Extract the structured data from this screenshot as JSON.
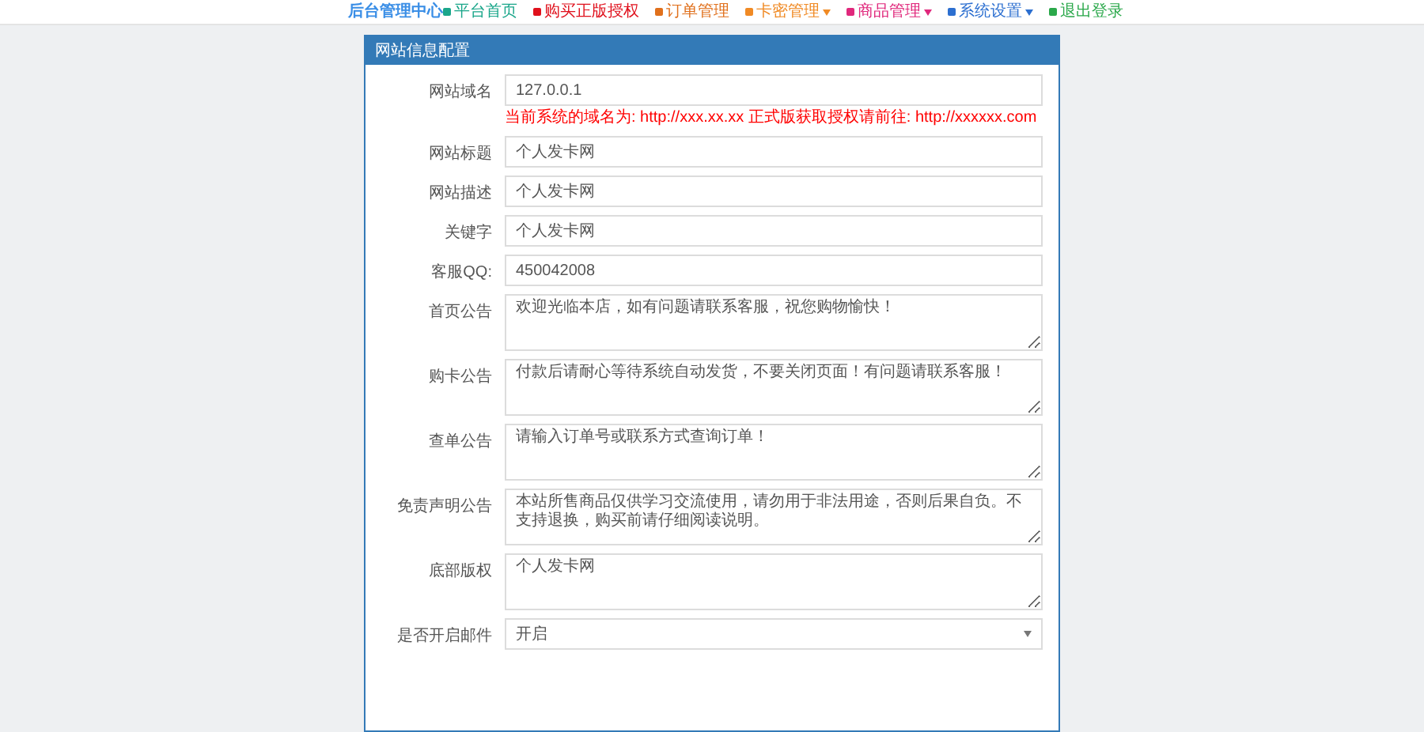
{
  "brand": "后台管理中心",
  "nav": [
    {
      "label": "平台首页",
      "color": "#1aa68a",
      "kind": "link"
    },
    {
      "label": "购买正版授权",
      "color": "#e0101c",
      "kind": "link"
    },
    {
      "label": "订单管理",
      "color": "#e0701c",
      "kind": "link"
    },
    {
      "label": "卡密管理",
      "color": "#f08a24",
      "kind": "menu"
    },
    {
      "label": "商品管理",
      "color": "#e0287c",
      "kind": "menu"
    },
    {
      "label": "系统设置",
      "color": "#2c6fd0",
      "kind": "menu"
    },
    {
      "label": "退出登录",
      "color": "#2aa84a",
      "kind": "link"
    }
  ],
  "panel": {
    "title": "网站信息配置",
    "fields": [
      {
        "kind": "input",
        "label": "网站域名",
        "value": "127.0.0.1",
        "note": "当前系统的域名为: http://xxx.xx.xx 正式版获取授权请前往: http://xxxxxx.com"
      },
      {
        "kind": "input",
        "label": "网站标题",
        "value": "个人发卡网"
      },
      {
        "kind": "input",
        "label": "网站描述",
        "value": "个人发卡网"
      },
      {
        "kind": "input",
        "label": "关键字",
        "value": "个人发卡网"
      },
      {
        "kind": "input",
        "label": "客服QQ:",
        "value": "450042008"
      },
      {
        "kind": "textarea",
        "label": "首页公告",
        "value": "欢迎光临本店，如有问题请联系客服，祝您购物愉快！"
      },
      {
        "kind": "textarea",
        "label": "购卡公告",
        "value": "付款后请耐心等待系统自动发货，不要关闭页面！有问题请联系客服！"
      },
      {
        "kind": "textarea",
        "label": "查单公告",
        "value": "请输入订单号或联系方式查询订单！"
      },
      {
        "kind": "textarea",
        "label": "免责声明公告",
        "value": "本站所售商品仅供学习交流使用，请勿用于非法用途，否则后果自负。不支持退换，购买前请仔细阅读说明。"
      },
      {
        "kind": "textarea",
        "label": "底部版权",
        "value": "个人发卡网"
      },
      {
        "kind": "select",
        "label": "是否开启邮件",
        "value": "开启"
      }
    ]
  }
}
